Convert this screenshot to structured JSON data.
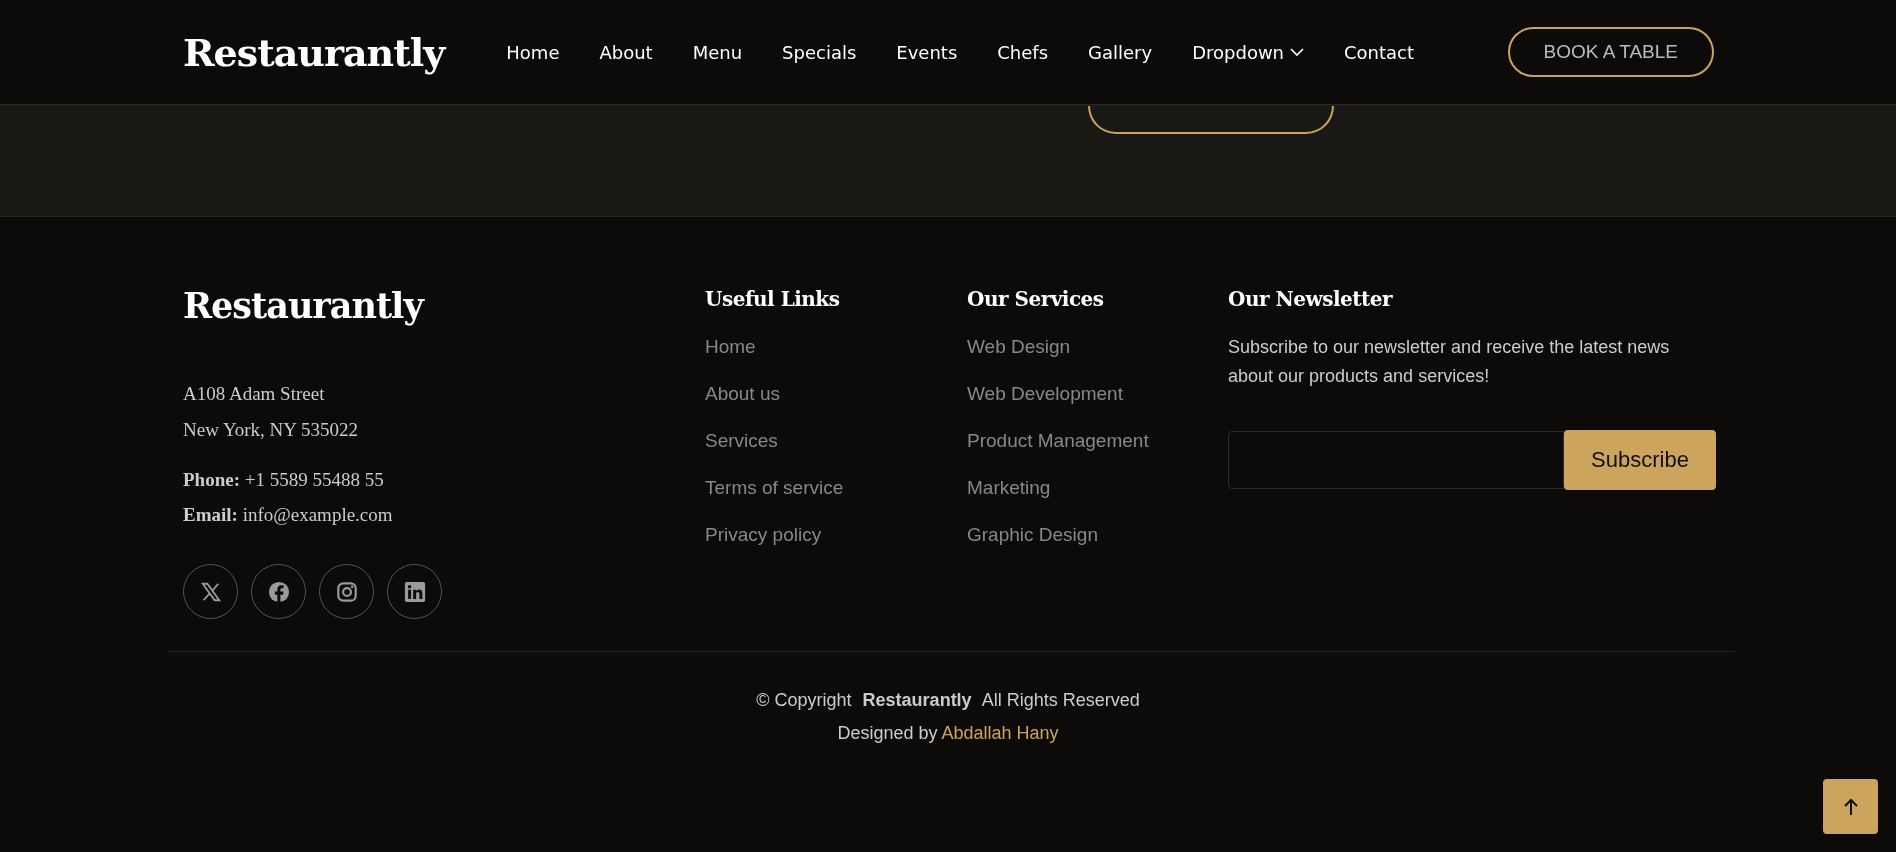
{
  "header": {
    "logo": "Restaurantly",
    "nav": [
      {
        "label": "Home",
        "kind": "link"
      },
      {
        "label": "About",
        "kind": "link"
      },
      {
        "label": "Menu",
        "kind": "link"
      },
      {
        "label": "Specials",
        "kind": "link"
      },
      {
        "label": "Events",
        "kind": "link"
      },
      {
        "label": "Chefs",
        "kind": "link"
      },
      {
        "label": "Gallery",
        "kind": "link"
      },
      {
        "label": "Dropdown",
        "kind": "dropdown"
      },
      {
        "label": "Contact",
        "kind": "link"
      }
    ],
    "cta": "BOOK A TABLE"
  },
  "footer": {
    "logo": "Restaurantly",
    "address": [
      "A108 Adam Street",
      "New York, NY 535022"
    ],
    "phone": {
      "label": "Phone:",
      "value": "+1 5589 55488 55"
    },
    "email": {
      "label": "Email:",
      "value": "info@example.com"
    },
    "social": [
      {
        "kind": "x"
      },
      {
        "kind": "facebook"
      },
      {
        "kind": "instagram"
      },
      {
        "kind": "linkedin"
      }
    ],
    "useful_links": {
      "title": "Useful Links",
      "items": [
        "Home",
        "About us",
        "Services",
        "Terms of service",
        "Privacy policy"
      ]
    },
    "services": {
      "title": "Our Services",
      "items": [
        "Web Design",
        "Web Development",
        "Product Management",
        "Marketing",
        "Graphic Design"
      ]
    },
    "newsletter": {
      "title": "Our Newsletter",
      "text": "Subscribe to our newsletter and receive the latest news about our products and services!",
      "button": "Subscribe"
    },
    "copyright": {
      "prefix": "© Copyright",
      "brand": "Restaurantly",
      "suffix": "All Rights Reserved"
    },
    "credit": {
      "prefix": "Designed by",
      "author": "Abdallah Hany"
    }
  }
}
